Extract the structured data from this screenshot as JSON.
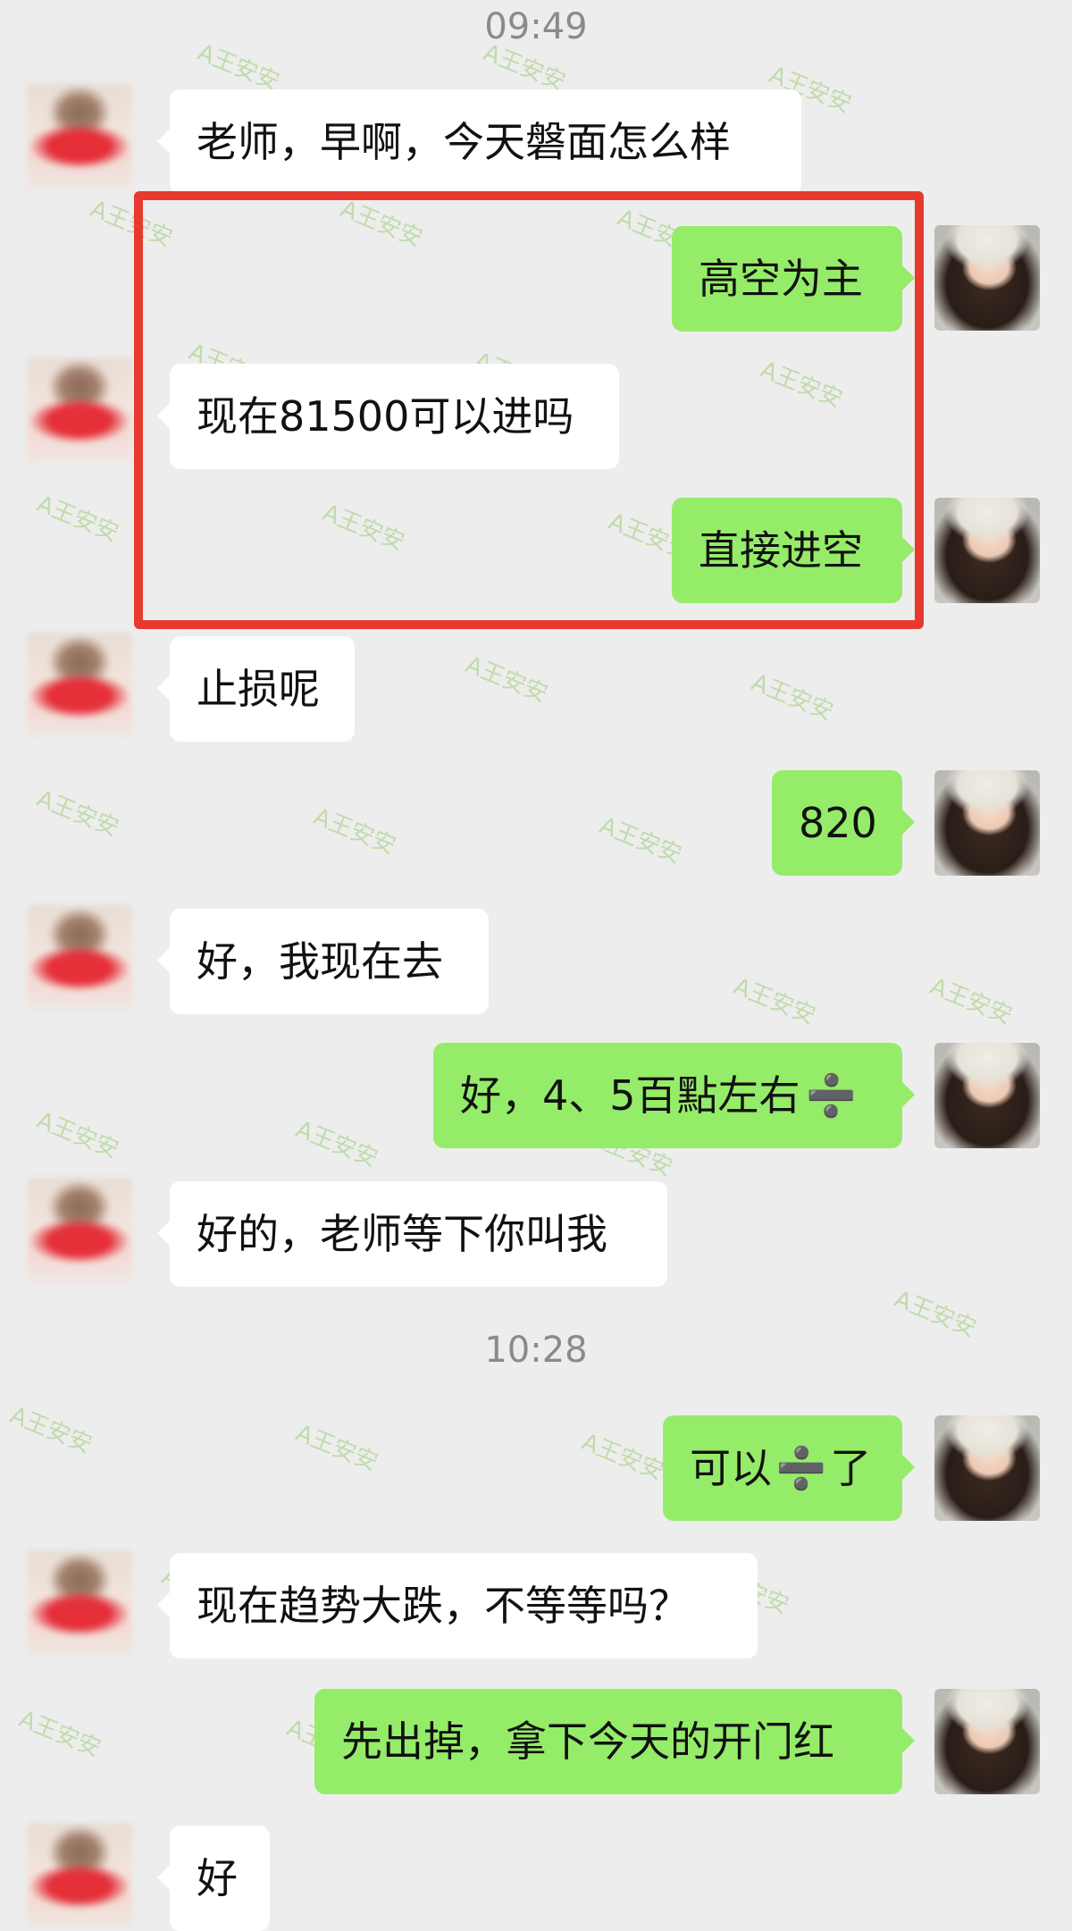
{
  "timestamps": [
    "09:49",
    "10:28"
  ],
  "messages": [
    {
      "side": "in",
      "text": "老师，早啊，今天磐面怎么样"
    },
    {
      "side": "out",
      "text": "高空为主"
    },
    {
      "side": "in",
      "text": "现在81500可以进吗"
    },
    {
      "side": "out",
      "text": "直接进空"
    },
    {
      "side": "in",
      "text": "止损呢"
    },
    {
      "side": "out",
      "text": "820"
    },
    {
      "side": "in",
      "text": "好，我现在去"
    },
    {
      "side": "out",
      "text": "好，4、5百點左右"
    },
    {
      "side": "in",
      "text": "好的，老师等下你叫我"
    },
    {
      "side": "out",
      "text": "可以"
    },
    {
      "side": "in",
      "text": "现在趋势大跌，不等等吗？"
    },
    {
      "side": "out",
      "text": "先出掉，拿下今天的开门红"
    },
    {
      "side": "in",
      "text": "好"
    }
  ],
  "emoji": {
    "divide": "➗",
    "divide_text_after": "了"
  },
  "watermark": {
    "text": "A王安安",
    "color": "#b9d9a0"
  },
  "colors": {
    "background": "#ededed",
    "bubble_out": "#95ec69",
    "bubble_in": "#ffffff",
    "highlight": "#e8392f"
  }
}
